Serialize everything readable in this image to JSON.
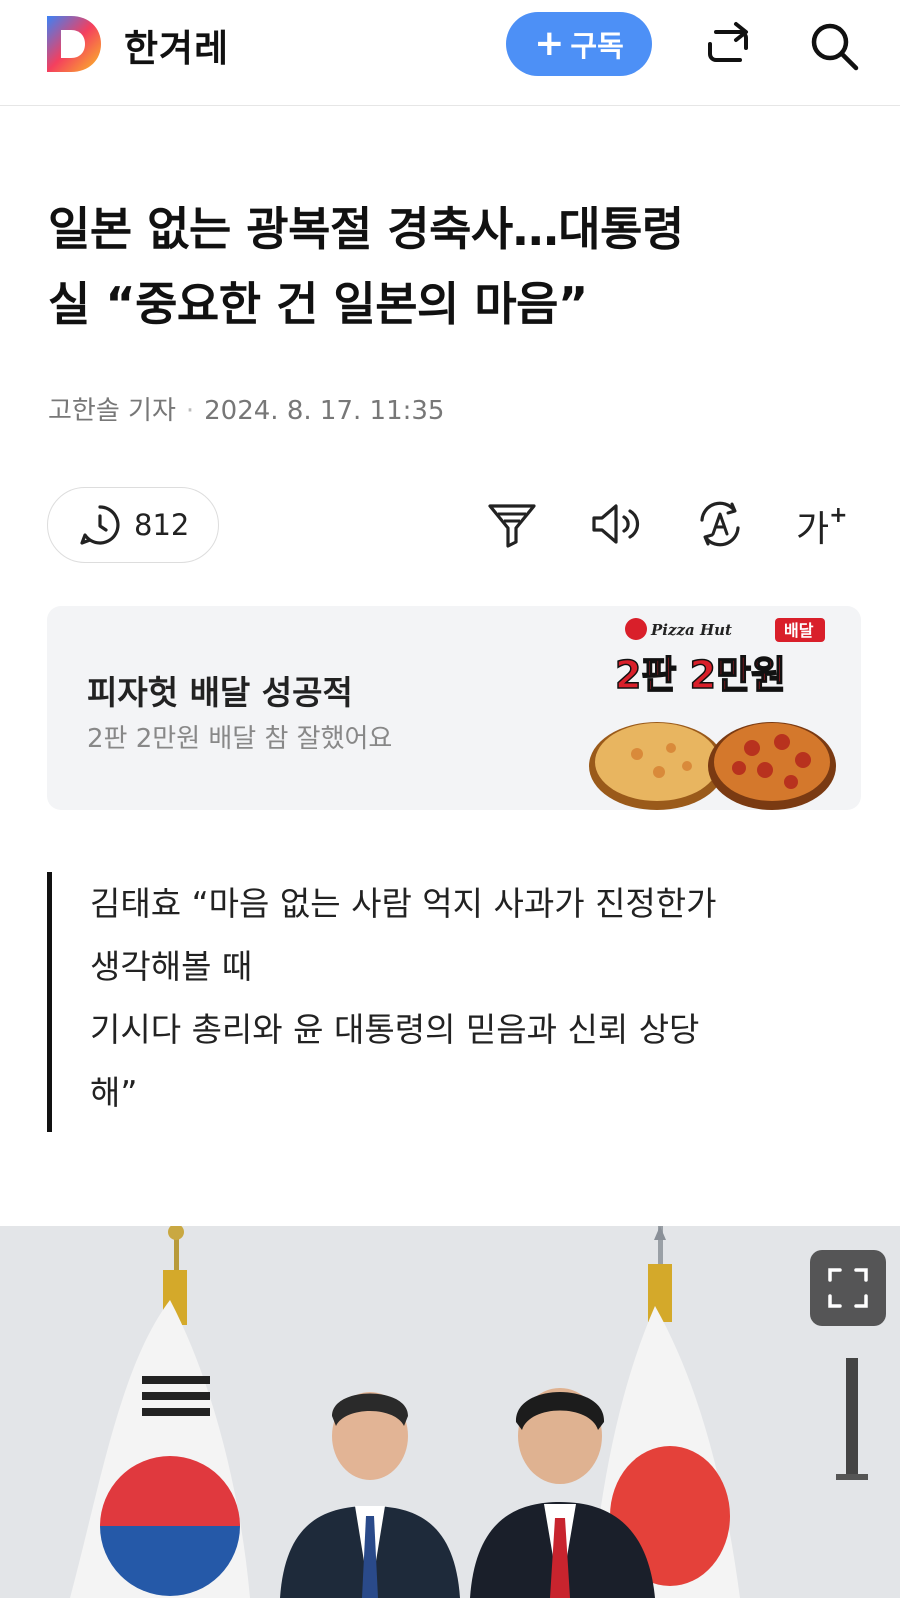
{
  "header": {
    "press_name": "한겨레",
    "subscribe_label": "구독",
    "subscribe_prefix": "+",
    "colors": {
      "accent": "#4d90f6"
    }
  },
  "article": {
    "headline_line1": "일본 없는 광복절 경축사…대통령",
    "headline_line2": "실 “중요한 건 일본의 마음”",
    "author": "고한솔 기자",
    "separator": "·",
    "datetime": "2024. 8. 17. 11:35"
  },
  "toolbar": {
    "comment_count": "812",
    "font_label": "가",
    "font_plus": "+",
    "icons": [
      "comment-icon",
      "filter-icon",
      "speaker-icon",
      "translate-icon",
      "font-size-icon"
    ]
  },
  "ad": {
    "title": "피자헛 배달 성공적",
    "subtitle": "2판 2만원 배달 참 잘했어요",
    "brand": "Pizza Hut",
    "badge": "배달",
    "promo": "2판 2만원"
  },
  "quote": {
    "lines": [
      "김태효 “마음 없는 사람 억지 사과가 진정한가",
      "생각해볼 때",
      "기시다 총리와 윤 대통령의 믿음과 신뢰 상당",
      "해”"
    ]
  },
  "photo": {
    "expand_icon": "expand-icon"
  }
}
